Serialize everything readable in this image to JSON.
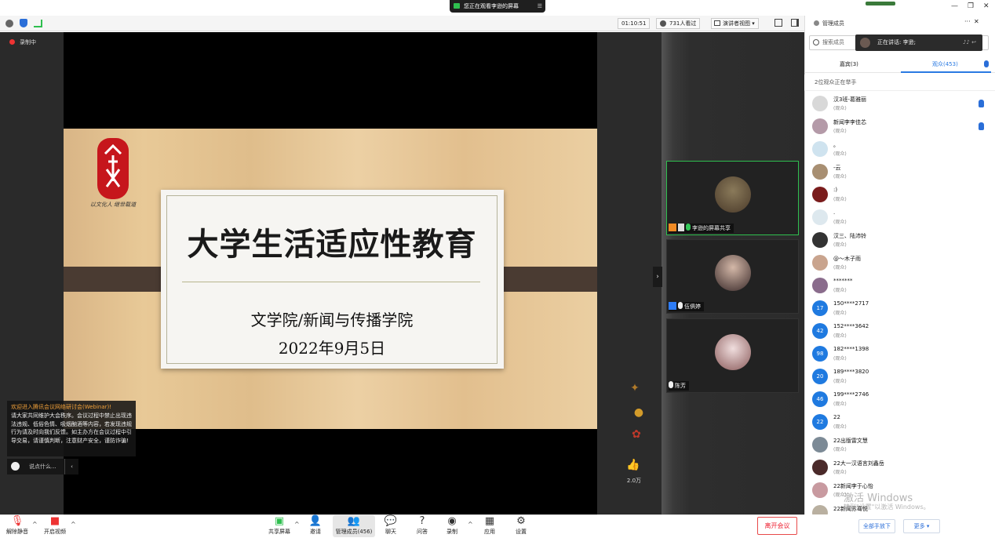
{
  "share_banner": "您正在观看李逊的屏幕",
  "top": {
    "timer": "01:10:51",
    "viewers": "731人看过",
    "view_mode": "演讲者视图"
  },
  "recording": "录制中",
  "slide": {
    "title": "大学生活适应性教育",
    "subtitle": "文学院/新闻与传播学院",
    "date": "2022年9月5日",
    "seal_text": "以文化人 继世载道"
  },
  "chat": {
    "welcome": "欢迎进入腾讯会议网络研讨会(Webinar)!",
    "body": "请大家共同维护大会秩序。会议过程中禁止出现违法违规、低俗色情、吸烟酗酒等内容，若发现违规行为请及时向我们反馈。如主办方在会议过程中引导交易，请谨慎判断，注意财产安全，谨防诈骗!",
    "placeholder": "说点什么..."
  },
  "videos": [
    {
      "label": "李逊的屏幕共享"
    },
    {
      "label": "伍俱婷"
    },
    {
      "label": "陈芳"
    }
  ],
  "likes": "2.0万",
  "toolbar": {
    "mute": "解除静音",
    "video": "开启视频",
    "share": "共享屏幕",
    "invite": "邀请",
    "members": "管理成员(456)",
    "chat": "聊天",
    "qa": "问答",
    "record": "录制",
    "apps": "应用",
    "settings": "设置",
    "leave": "离开会议"
  },
  "panel": {
    "title": "管理成员",
    "search": "搜索成员",
    "speaking": "正在讲话: 李逊;",
    "tab_guests": "嘉宾(3)",
    "tab_audience": "观众(453)",
    "raise_note": "2位观众正在举手",
    "members": [
      {
        "name": "汉3班-葛雅丽",
        "role": "(观众)",
        "hand": true,
        "color": "#d8d8d8",
        "initial": ""
      },
      {
        "name": "新闻李李佳芯",
        "role": "(观众)",
        "hand": true,
        "color": "#b49aa8",
        "initial": ""
      },
      {
        "name": "。",
        "role": "(观众)",
        "hand": false,
        "color": "#cfe3ef",
        "initial": ""
      },
      {
        "name": "-云",
        "role": "(观众)",
        "hand": false,
        "color": "#a88f72",
        "initial": ""
      },
      {
        "name": ":)",
        "role": "(观众)",
        "hand": false,
        "color": "#7a1c1c",
        "initial": ""
      },
      {
        "name": ".",
        "role": "(观众)",
        "hand": false,
        "color": "#dde8ee",
        "initial": ""
      },
      {
        "name": "汉三、陆沛铃",
        "role": "(观众)",
        "hand": false,
        "color": "#333333",
        "initial": ""
      },
      {
        "name": "@～木子雨",
        "role": "(观众)",
        "hand": false,
        "color": "#c9a48e",
        "initial": ""
      },
      {
        "name": "*******",
        "role": "(观众)",
        "hand": false,
        "color": "#8a6c8c",
        "initial": ""
      },
      {
        "name": "150****2717",
        "role": "(观众)",
        "hand": false,
        "color": "#1f7ae0",
        "initial": "17"
      },
      {
        "name": "152****3642",
        "role": "(观众)",
        "hand": false,
        "color": "#1f7ae0",
        "initial": "42"
      },
      {
        "name": "182****1398",
        "role": "(观众)",
        "hand": false,
        "color": "#1f7ae0",
        "initial": "98"
      },
      {
        "name": "189****3820",
        "role": "(观众)",
        "hand": false,
        "color": "#1f7ae0",
        "initial": "20"
      },
      {
        "name": "199****2746",
        "role": "(观众)",
        "hand": false,
        "color": "#1f7ae0",
        "initial": "46"
      },
      {
        "name": "22",
        "role": "(观众)",
        "hand": false,
        "color": "#1f7ae0",
        "initial": "22"
      },
      {
        "name": "22出版雷文慧",
        "role": "(观众)",
        "hand": false,
        "color": "#7c8a96",
        "initial": ""
      },
      {
        "name": "22大一汉语言刘鑫岳",
        "role": "(观众)",
        "hand": false,
        "color": "#4a2a2a",
        "initial": ""
      },
      {
        "name": "22新闻李于心怡",
        "role": "(观众)",
        "hand": false,
        "color": "#c89aa0",
        "initial": ""
      },
      {
        "name": "22新闻苏骞悦",
        "role": "(观众)",
        "hand": false,
        "color": "#b9b0a0",
        "initial": ""
      }
    ],
    "footer_lower": "全部手放下",
    "footer_more": "更多",
    "watermark1": "激活 Windows",
    "watermark2": "转到\"设置\"以激活 Windows。"
  }
}
